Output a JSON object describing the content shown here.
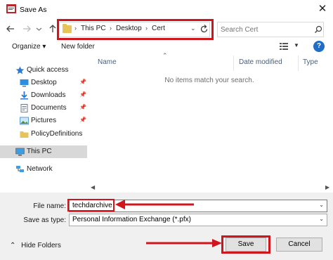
{
  "window": {
    "title": "Save As",
    "close_glyph": "✕"
  },
  "nav": {
    "back_icon": "back-arrow-icon",
    "forward_icon": "forward-arrow-icon",
    "recent_icon": "chevron-down-icon",
    "up_icon": "up-arrow-icon",
    "breadcrumb": [
      "This PC",
      "Desktop",
      "Cert"
    ],
    "search_placeholder": "Search Cert"
  },
  "toolbar": {
    "organize_label": "Organize ▾",
    "new_folder_label": "New folder"
  },
  "sidebar": {
    "items": [
      {
        "label": "Quick access",
        "icon": "star-icon",
        "pinned": false
      },
      {
        "label": "Desktop",
        "icon": "desktop-icon",
        "pinned": true
      },
      {
        "label": "Downloads",
        "icon": "download-icon",
        "pinned": true
      },
      {
        "label": "Documents",
        "icon": "documents-icon",
        "pinned": true
      },
      {
        "label": "Pictures",
        "icon": "pictures-icon",
        "pinned": true
      },
      {
        "label": "PolicyDefinitions",
        "icon": "folder-icon",
        "pinned": false
      },
      {
        "label": "This PC",
        "icon": "computer-icon",
        "pinned": false,
        "selected": true
      },
      {
        "label": "Network",
        "icon": "network-icon",
        "pinned": false
      }
    ]
  },
  "file_list": {
    "columns": [
      "Name",
      "Date modified",
      "Type"
    ],
    "empty_message": "No items match your search."
  },
  "form": {
    "file_name_label": "File name:",
    "file_name_value": "techdarchive",
    "save_as_type_label": "Save as type:",
    "save_as_type_value": "Personal Information Exchange (*.pfx)"
  },
  "footer": {
    "hide_folders_label": "Hide Folders",
    "save_label": "Save",
    "cancel_label": "Cancel"
  },
  "colors": {
    "highlight_red": "#d0151d",
    "selection_gray": "#d8d8d8",
    "help_blue": "#1f6dc5"
  }
}
